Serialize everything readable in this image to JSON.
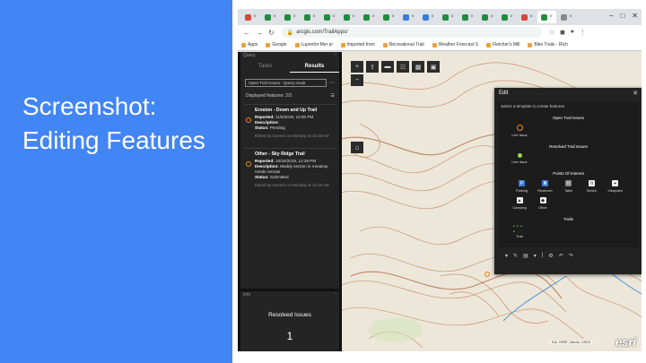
{
  "slide": {
    "title": "Screenshot: Editing Features",
    "bg_color": "#4285f4"
  },
  "browser": {
    "tabs": [
      {
        "icon": "gmail-icon",
        "label": "M",
        "color": "#db4437"
      },
      {
        "icon": "tab-icon",
        "label": "",
        "color": "#1e8e3e"
      },
      {
        "icon": "tab-icon",
        "label": "",
        "color": "#1e8e3e"
      },
      {
        "icon": "tab-icon",
        "label": "",
        "color": "#1e8e3e"
      },
      {
        "icon": "tab-icon",
        "label": "",
        "color": "#1e8e3e"
      },
      {
        "icon": "tab-icon",
        "label": "",
        "color": "#1e8e3e"
      },
      {
        "icon": "tab-icon",
        "label": "",
        "color": "#1e8e3e"
      },
      {
        "icon": "tab-icon",
        "label": "",
        "color": "#1e8e3e"
      },
      {
        "icon": "tab-icon",
        "label": "",
        "color": "#3b7bdc"
      },
      {
        "icon": "tab-icon",
        "label": "",
        "color": "#3b7bdc"
      },
      {
        "icon": "tab-icon",
        "label": "",
        "color": "#1e8e3e"
      },
      {
        "icon": "tab-icon",
        "label": "",
        "color": "#1e8e3e"
      },
      {
        "icon": "tab-icon",
        "label": "",
        "color": "#1e8e3e"
      },
      {
        "icon": "tab-icon",
        "label": "",
        "color": "#1e8e3e"
      },
      {
        "icon": "tab-icon",
        "label": "",
        "color": "#db4437"
      },
      {
        "icon": "tab-icon",
        "label": "",
        "color": "#1e8e3e"
      },
      {
        "icon": "tab-icon",
        "label": "",
        "color": "#888888"
      }
    ],
    "url": "arcgis.com/TrailApps/",
    "bookmarks": [
      "Apps",
      "Google",
      "Lupenfor Mer pl",
      "Imported from",
      "Recreational Trail",
      "Weather Forecast S",
      "Fletcher's Mill",
      "Bike Trails - Rich"
    ]
  },
  "query_panel": {
    "header": "Query",
    "tabs": [
      "Tasks",
      "Results"
    ],
    "active_tab": "Results",
    "select_value": "Open Trail Issues - Query result",
    "count_text": "Displayed features: 2/2",
    "results": [
      {
        "title": "Erosion - Down and Up Trail",
        "reported": "11/5/2019, 12:00 PM",
        "description": "",
        "status": "Pending",
        "footer": "Edited by Generic on Monday at 10:16 AM"
      },
      {
        "title": "Other - Sky Ridge Trail",
        "reported": "10/18/2019, 12:39 PM",
        "description": "Muddy section in meadow, needs reroute",
        "status": "Submitted",
        "footer": "Edited by Generic on Monday at 10:16 AM"
      }
    ]
  },
  "info_panel": {
    "header": "Info",
    "title": "Resolved Issues",
    "value": "1"
  },
  "edit_dialog": {
    "title": "Edit",
    "instruction": "Select a template to create features",
    "groups": [
      {
        "name": "Open Trail Issues",
        "items": [
          {
            "label": "Line Issue",
            "symbol": "orange-circle"
          }
        ]
      },
      {
        "name": "Resolved Trail Issues",
        "items": [
          {
            "label": "Line Issue",
            "symbol": "green-dot"
          }
        ]
      },
      {
        "name": "Points Of Interest",
        "items": [
          {
            "label": "Parking",
            "symbol": "parking-icon"
          },
          {
            "label": "Restroom",
            "symbol": "restroom-icon"
          },
          {
            "label": "Table",
            "symbol": "table-icon"
          },
          {
            "label": "Bench",
            "symbol": "bench-icon"
          },
          {
            "label": "Viewpoint",
            "symbol": "viewpoint-icon"
          },
          {
            "label": "Camping",
            "symbol": "camping-icon"
          },
          {
            "label": "Other",
            "symbol": "other-icon"
          }
        ]
      },
      {
        "name": "Trails",
        "items": [
          {
            "label": "Trail",
            "symbol": "trail-line"
          }
        ]
      }
    ]
  },
  "map": {
    "attribution": "Esri, HERE, Garmin, USGS",
    "logo": "esri"
  },
  "colors": {
    "accent_blue": "#4285f4",
    "issue_orange": "#f08a24",
    "resolved_green": "#9bd84b",
    "panel_dark": "#242424"
  }
}
